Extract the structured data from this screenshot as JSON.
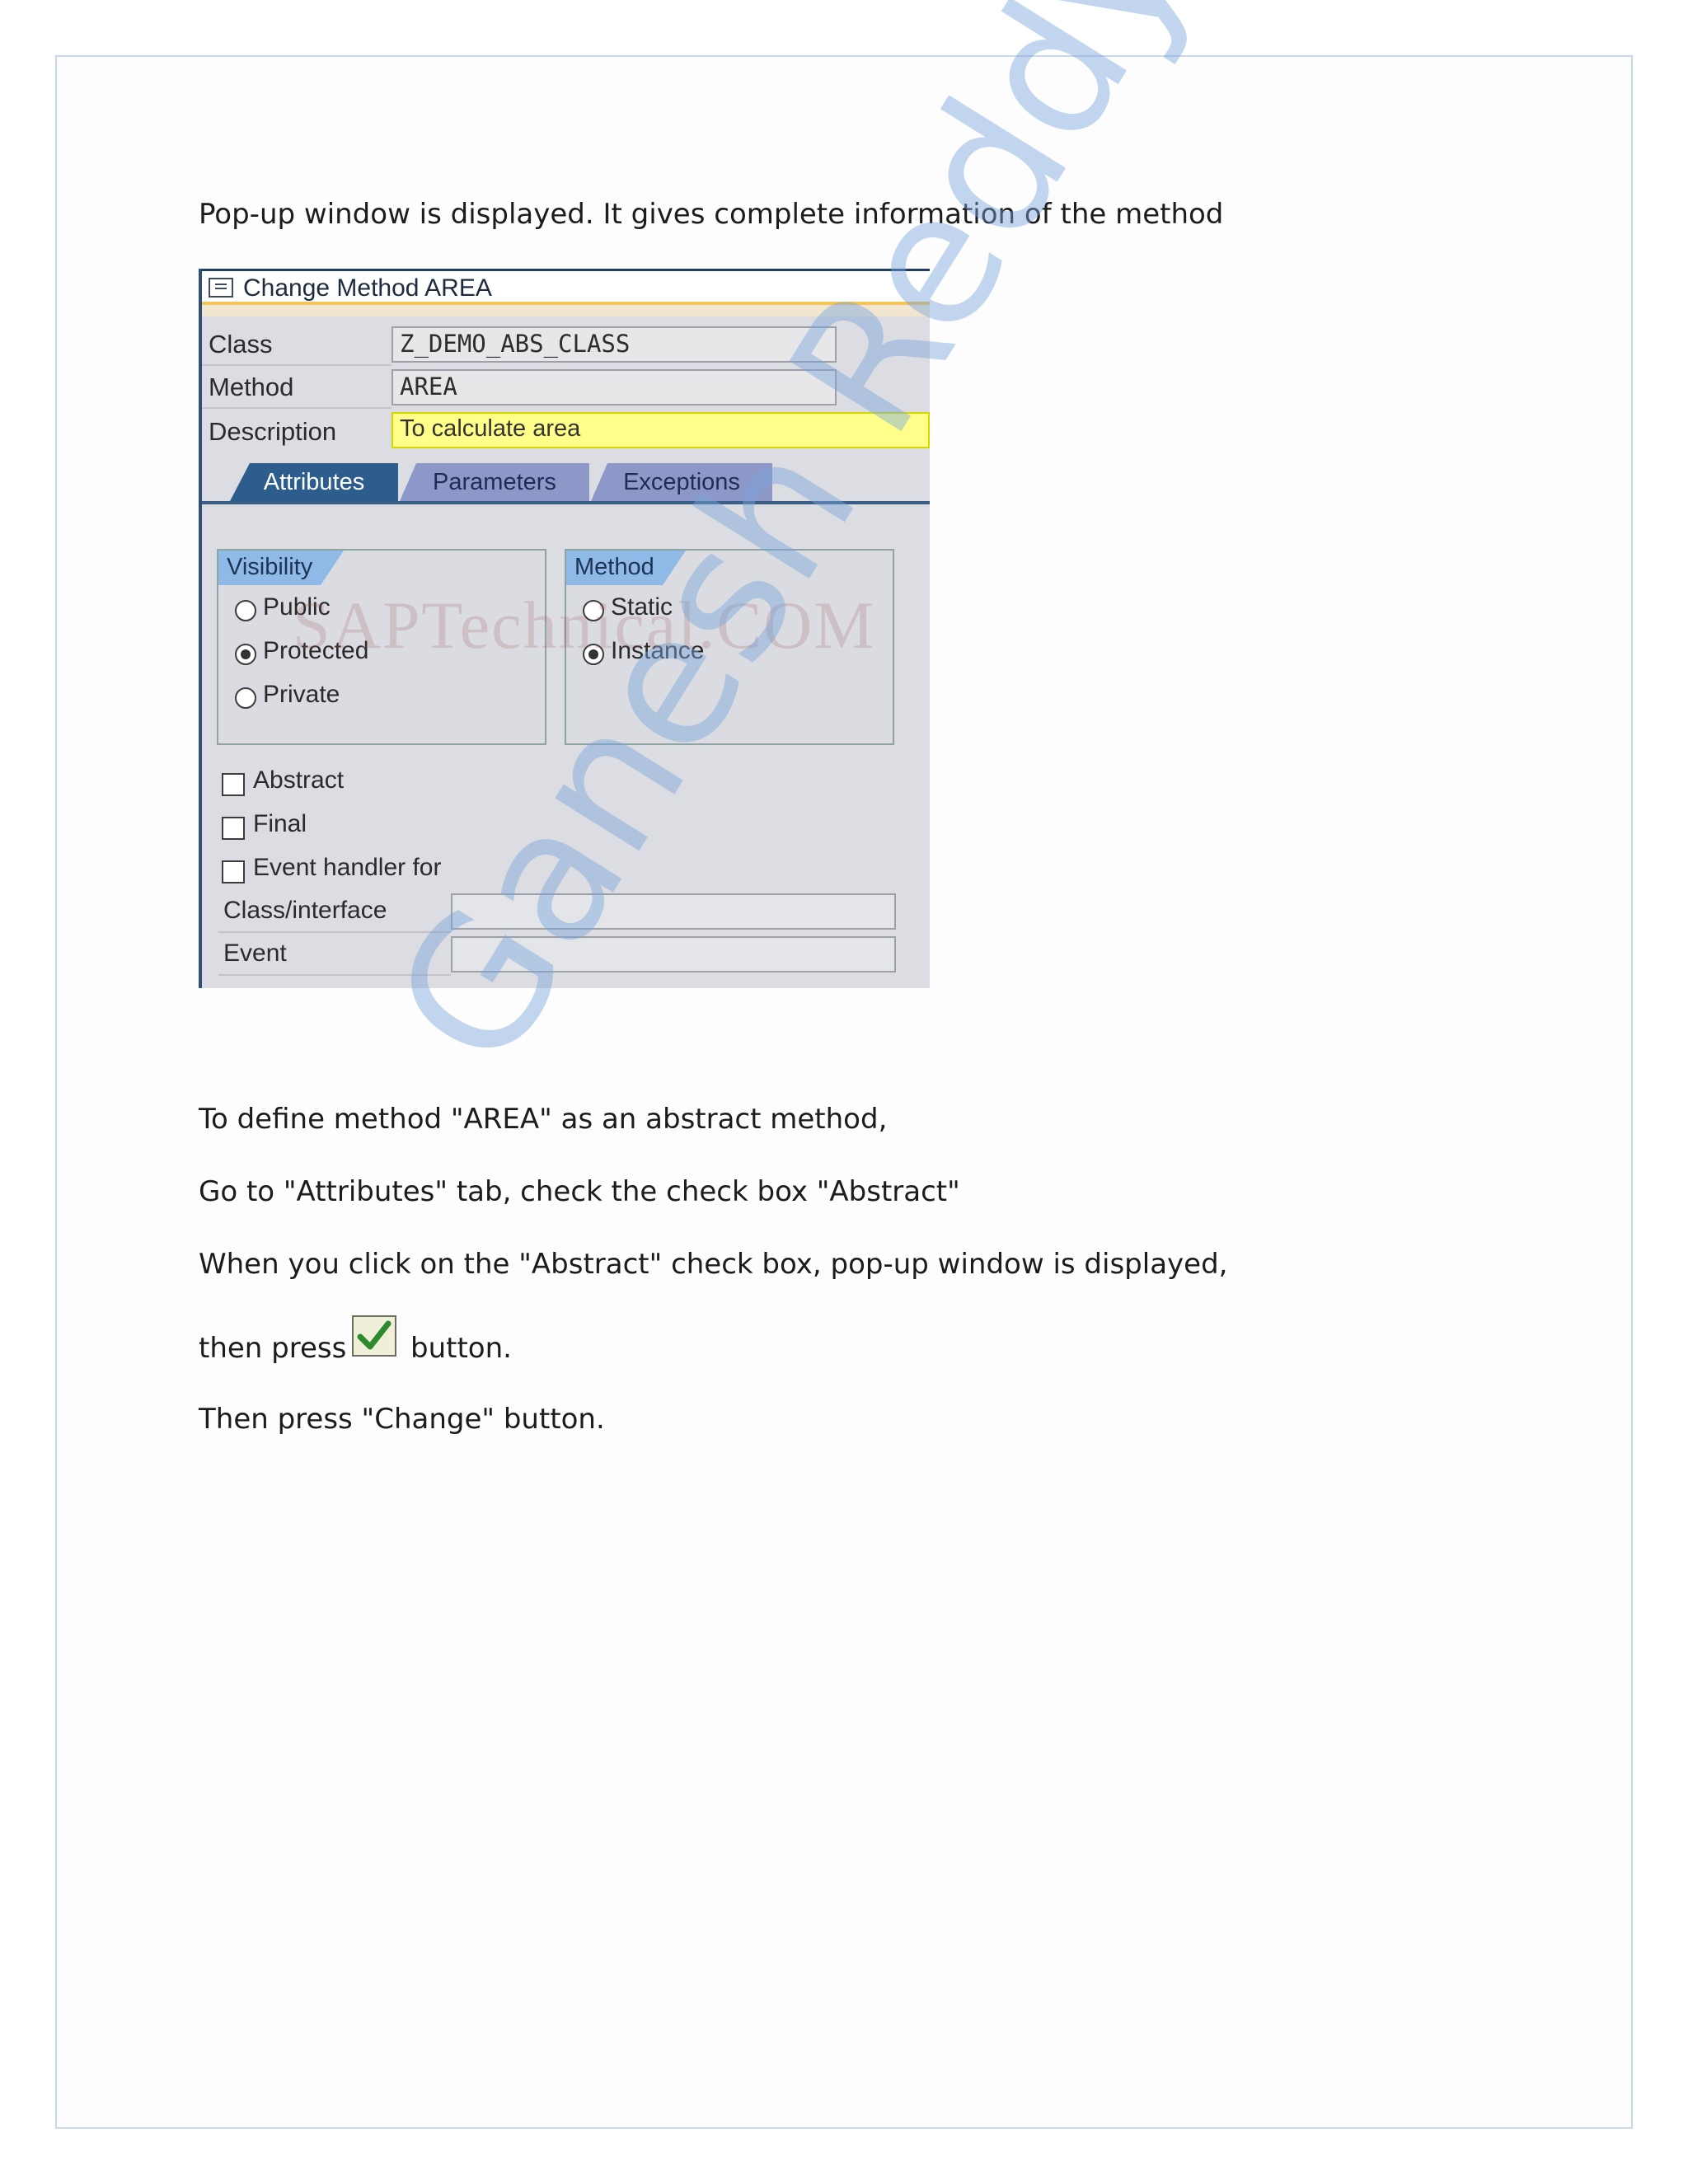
{
  "paragraphs": {
    "intro": "Pop-up window is displayed. It gives complete information of the method",
    "p1": "To define method \"AREA\" as an abstract method,",
    "p2": "Go to \"Attributes\" tab, check the check box \"Abstract\"",
    "p3": "When you click on the \"Abstract\" check box, pop-up window is displayed,",
    "p4_before": "then press",
    "p4_after": "button.",
    "p5": "Then press \"Change\" button."
  },
  "dialog": {
    "title": "Change Method AREA",
    "fields": {
      "class_label": "Class",
      "class_value": "Z_DEMO_ABS_CLASS",
      "method_label": "Method",
      "method_value": "AREA",
      "description_label": "Description",
      "description_value": "To calculate area"
    },
    "tabs": [
      "Attributes",
      "Parameters",
      "Exceptions"
    ],
    "active_tab": "Attributes",
    "visibility": {
      "heading": "Visibility",
      "options": [
        "Public",
        "Protected",
        "Private"
      ],
      "selected": "Protected"
    },
    "method_kind": {
      "heading": "Method",
      "options": [
        "Static",
        "Instance"
      ],
      "selected": "Instance"
    },
    "checkboxes": [
      "Abstract",
      "Final",
      "Event handler for"
    ],
    "event_fields": {
      "class_interface_label": "Class/interface",
      "event_label": "Event"
    },
    "image_watermark": "SAPTechnical.COM"
  },
  "watermark": "Ganesh Reddy",
  "icons": {
    "title_icon": "change-dialog-icon",
    "confirm_icon": "green-check-icon"
  },
  "colors": {
    "description_bg": "#ffff8a",
    "active_tab": "#2d5d8c",
    "inactive_tab": "#8d98c8",
    "group_header": "#8fb9e7",
    "watermark": "#78a5dc"
  }
}
